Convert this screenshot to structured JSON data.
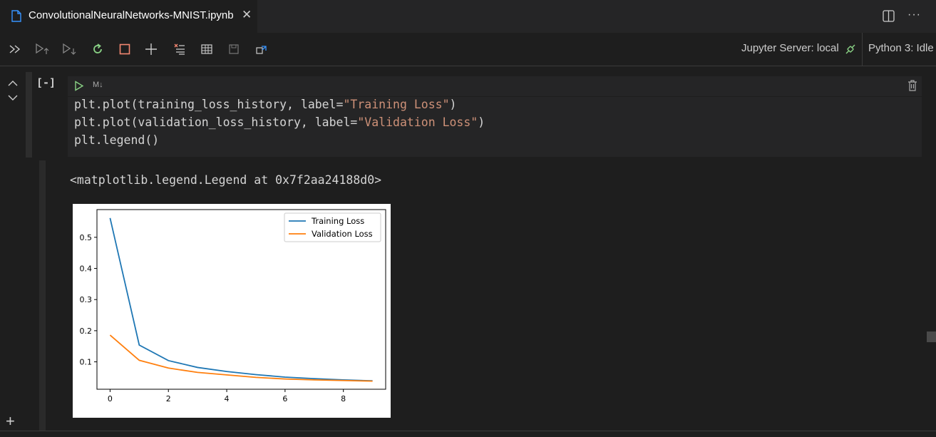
{
  "tab": {
    "title": "ConvolutionalNeuralNetworks-MNIST.ipynb",
    "close_glyph": "✕",
    "more_glyph": "···"
  },
  "toolbar": {
    "icons": [
      "run-all-icon",
      "run-above-icon",
      "run-below-icon",
      "restart-kernel-icon",
      "interrupt-kernel-icon",
      "add-cell-icon",
      "clear-outputs-icon",
      "variables-icon",
      "save-icon",
      "export-icon"
    ],
    "server_label": "Jupyter Server: local",
    "kernel_label": "Python 3: Idle"
  },
  "cell": {
    "exec_count": "[-]",
    "cell_type_label": "M↓",
    "add_glyph": "+",
    "code": {
      "line1": {
        "pre": "plt.plot(training_loss_history, label=",
        "str": "\"Training Loss\"",
        "post": ")"
      },
      "line2": {
        "pre": "plt.plot(validation_loss_history, label=",
        "str": "\"Validation Loss\"",
        "post": ")"
      },
      "line3": {
        "pre": "plt.legend()"
      }
    },
    "output_text": "<matplotlib.legend.Legend at 0x7f2aa24188d0>"
  },
  "colors": {
    "accent": "#3794ff",
    "run_green": "#89d185",
    "restart_green": "#89d185",
    "interrupt_red": "#f48771",
    "string_orange": "#ce9178"
  },
  "chart_data": {
    "type": "line",
    "x": [
      0,
      1,
      2,
      3,
      4,
      5,
      6,
      7,
      8,
      9
    ],
    "series": [
      {
        "name": "Training Loss",
        "color": "#1f77b4",
        "values": [
          0.562,
          0.154,
          0.104,
          0.082,
          0.069,
          0.059,
          0.051,
          0.046,
          0.042,
          0.039
        ]
      },
      {
        "name": "Validation Loss",
        "color": "#ff7f0e",
        "values": [
          0.186,
          0.105,
          0.08,
          0.066,
          0.058,
          0.05,
          0.045,
          0.042,
          0.04,
          0.038
        ]
      }
    ],
    "xticks": [
      0,
      2,
      4,
      6,
      8
    ],
    "yticks": [
      0.1,
      0.2,
      0.3,
      0.4,
      0.5
    ],
    "xlim": [
      -0.45,
      9.45
    ],
    "ylim": [
      0.012,
      0.589
    ],
    "legend": "top-right",
    "grid": false
  }
}
